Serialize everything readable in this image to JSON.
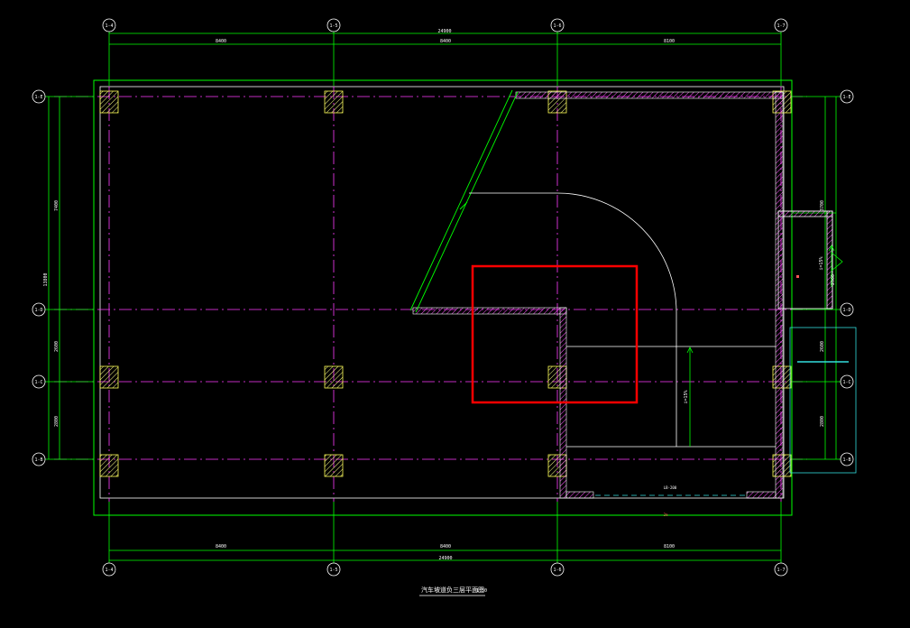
{
  "drawing": {
    "title": "汽车坡道负三层平面图",
    "scale": "1:50",
    "axes_vertical": [
      "1-4",
      "1-5",
      "1-6",
      "1-7"
    ],
    "axes_horizontal": [
      "1-E",
      "1-D",
      "1-C",
      "1-B"
    ],
    "top_dims": {
      "total": "24900",
      "seg1": "8400",
      "seg2": "8400",
      "seg3": "8100"
    },
    "bottom_dims": {
      "total": "24900",
      "seg1": "8400",
      "seg2": "8400",
      "seg3": "8100"
    },
    "left_dims": {
      "total": "13800",
      "seg_top": "7400",
      "seg_mid": "2600",
      "seg_bot": "2800"
    },
    "right_dims": {
      "seg_top": "3700",
      "seg_top2": "2900",
      "seg_mid": "2600",
      "seg_bot": "2800"
    },
    "ramp_label": "i=15%",
    "right_note": "i=15%",
    "bottom_wall_label": "LB-200",
    "small_mark": "2m"
  },
  "colors": {
    "background": "#000000",
    "dimension": "#00ff00",
    "wall": "#ffffff",
    "column": "#ffff55",
    "axis": "#ff3cff",
    "cyan": "#33dddd",
    "highlight": "#ff0000"
  }
}
